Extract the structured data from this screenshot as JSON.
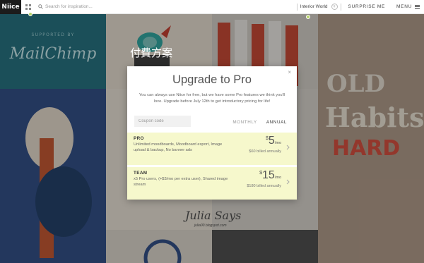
{
  "app": {
    "logo_text": "Niice"
  },
  "search": {
    "placeholder": "Search for inspiration..."
  },
  "topbar": {
    "topic_label": "Interior World",
    "add_label": "+",
    "surprise_label": "SURPRISE ME",
    "menu_label": "MENU"
  },
  "background": {
    "sponsor_label": "SUPPORTED BY",
    "sponsor_name": "MailChimp",
    "overlay_heading": "付費方案",
    "julia_title": "Julia Says",
    "julia_sub": "julia00.blogspot.com"
  },
  "modal": {
    "title": "Upgrade to Pro",
    "close_label": "×",
    "description": "You can always use Niice for free, but we have some Pro features we think you'll love. Upgrade before July 12th to get introductory pricing for life!",
    "coupon_placeholder": "Coupon code",
    "billing": {
      "monthly_label": "MONTHLY",
      "annual_label": "ANNUAL",
      "selected": "ANNUAL"
    },
    "plans": [
      {
        "name": "PRO",
        "description": "Unlimited moodboards, Moodboard export, Image upload & backup, No banner ads",
        "currency": "$",
        "price": "5",
        "period": "/mo",
        "billed": "$60 billed annually"
      },
      {
        "name": "TEAM",
        "description": "x5 Pro users, (+$3/mo per extra user), Shared image stream",
        "currency": "$",
        "price": "15",
        "period": "/mo",
        "billed": "$180 billed annually"
      }
    ]
  },
  "colors": {
    "accent_green": "#b7d36a",
    "plan_highlight": "#f6f8cc",
    "logo_bg": "#1c1c1c"
  },
  "icons": [
    "grid-icon",
    "search-icon",
    "plus-icon",
    "hamburger-icon",
    "close-icon",
    "chevron-right-icon"
  ]
}
